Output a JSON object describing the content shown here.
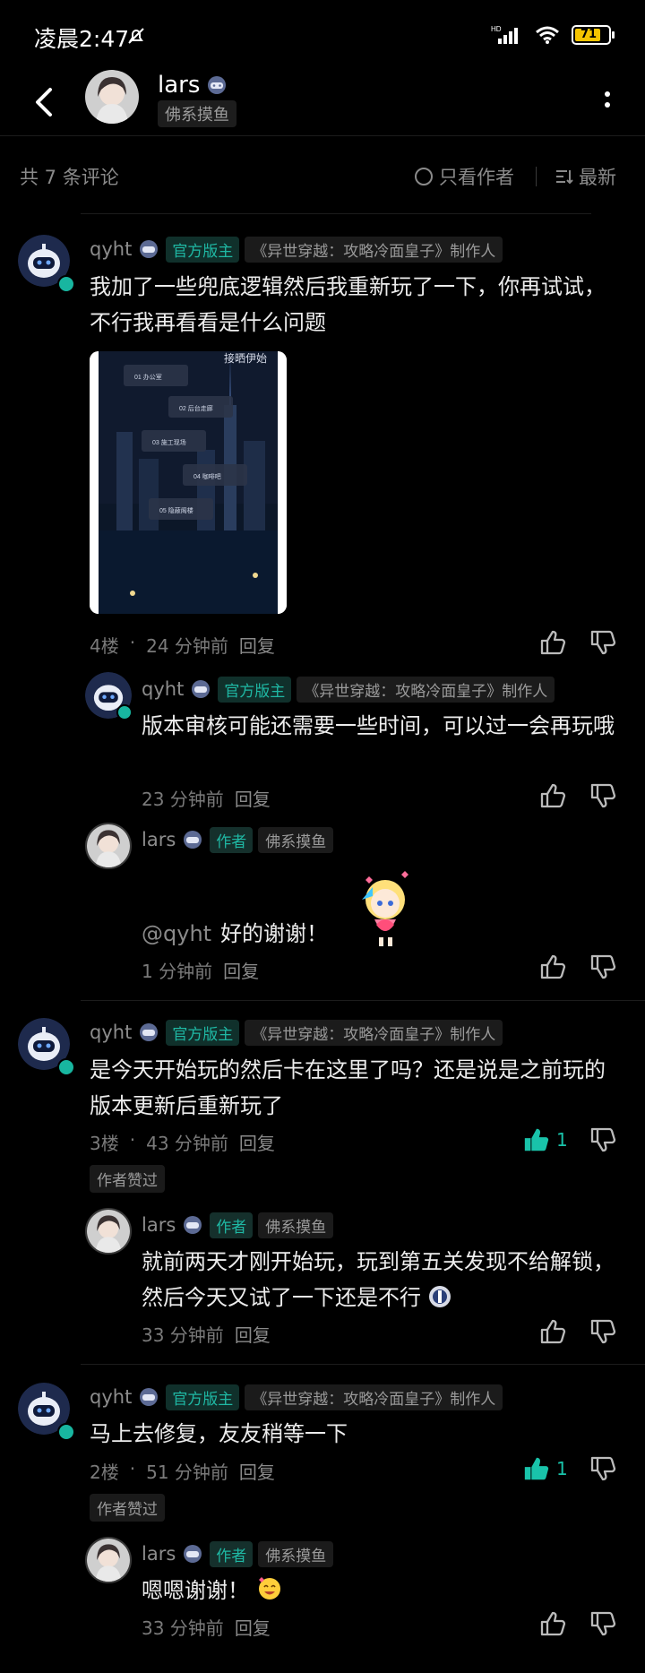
{
  "status_bar": {
    "time": "凌晨2:47",
    "network_badge": "HD",
    "battery_level": "71"
  },
  "header": {
    "name": "lars",
    "tag": "佛系摸鱼"
  },
  "sort_bar": {
    "comment_count": "共 7 条评论",
    "only_author": "只看作者",
    "latest": "最新"
  },
  "comments": [
    {
      "user": "qyht",
      "role": "官方版主",
      "title": "《异世穿越：攻略冷面皇子》制作人",
      "text": "我加了一些兜底逻辑然后我重新玩了一下，你再试试，不行我再看看是什么问题",
      "floor": "4楼",
      "time": "24 分钟前",
      "reply": "回复",
      "screenshot": {
        "header": "接晒伊始",
        "menu": [
          "01 办公室",
          "02 后台走廊",
          "03 施工现场",
          "04 咖啡吧",
          "05 隐蔽阁楼"
        ]
      },
      "replies": [
        {
          "user": "qyht",
          "role": "官方版主",
          "title": "《异世穿越：攻略冷面皇子》制作人",
          "text": "版本审核可能还需要一些时间，可以过一会再玩哦",
          "time": "23 分钟前",
          "reply": "回复"
        },
        {
          "user": "lars",
          "role": "作者",
          "title": "佛系摸鱼",
          "mention": "@qyht",
          "text": "好的谢谢！",
          "time": "1 分钟前",
          "reply": "回复"
        }
      ]
    },
    {
      "user": "qyht",
      "role": "官方版主",
      "title": "《异世穿越：攻略冷面皇子》制作人",
      "text": "是今天开始玩的然后卡在这里了吗？还是说是之前玩的版本更新后重新玩了",
      "floor": "3楼",
      "time": "43 分钟前",
      "reply": "回复",
      "likes": "1",
      "author_liked": "作者赞过",
      "replies": [
        {
          "user": "lars",
          "role": "作者",
          "title": "佛系摸鱼",
          "text": "就前两天才刚开始玩，玩到第五关发现不给解锁，然后今天又试了一下还是不行",
          "time": "33 分钟前",
          "reply": "回复"
        }
      ]
    },
    {
      "user": "qyht",
      "role": "官方版主",
      "title": "《异世穿越：攻略冷面皇子》制作人",
      "text": "马上去修复，友友稍等一下",
      "floor": "2楼",
      "time": "51 分钟前",
      "reply": "回复",
      "likes": "1",
      "author_liked": "作者赞过",
      "replies": [
        {
          "user": "lars",
          "role": "作者",
          "title": "佛系摸鱼",
          "text": "嗯嗯谢谢！",
          "time": "33 分钟前",
          "reply": "回复"
        }
      ]
    }
  ],
  "colors": {
    "accent": "#1fb8a4",
    "background": "#000000",
    "muted_text": "#8a8a8a"
  }
}
